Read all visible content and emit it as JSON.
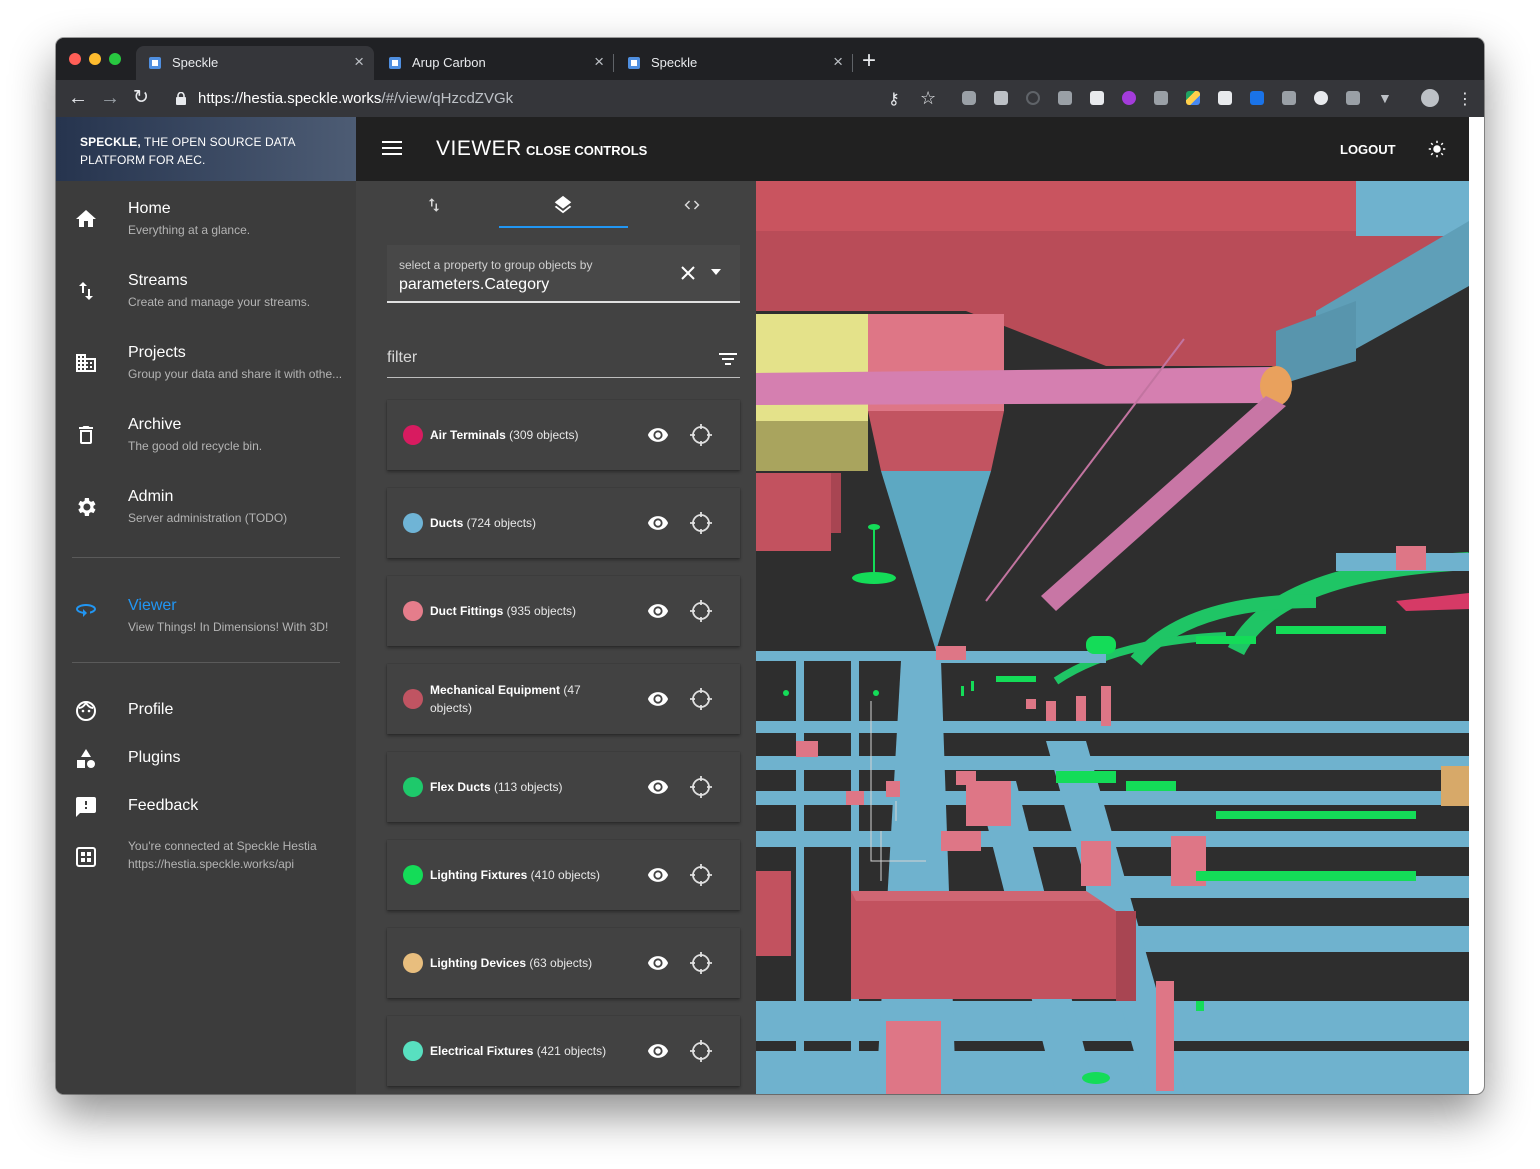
{
  "browser": {
    "tabs": [
      {
        "title": "Speckle",
        "active": true
      },
      {
        "title": "Arup Carbon",
        "active": false
      },
      {
        "title": "Speckle",
        "active": false
      }
    ],
    "url_host": "https://hestia.speckle.works",
    "url_path": "/#/view/qHzcdZVGk"
  },
  "brand": {
    "name": "SPECKLE,",
    "tagline": " THE OPEN SOURCE DATA PLATFORM FOR AEC."
  },
  "sidebar": {
    "items": [
      {
        "title": "Home",
        "subtitle": "Everything at a glance.",
        "icon": "home-icon"
      },
      {
        "title": "Streams",
        "subtitle": "Create and manage your streams.",
        "icon": "swap-vertical-icon"
      },
      {
        "title": "Projects",
        "subtitle": "Group your data and share it with othe...",
        "icon": "building-icon"
      },
      {
        "title": "Archive",
        "subtitle": "The good old recycle bin.",
        "icon": "trash-icon"
      },
      {
        "title": "Admin",
        "subtitle": "Server administration (TODO)",
        "icon": "gear-icon"
      }
    ],
    "viewer": {
      "title": "Viewer",
      "subtitle": "View Things! In Dimensions! With 3D!",
      "icon": "rotate-3d-icon",
      "color": "#2196f3"
    },
    "bottom_items": [
      {
        "title": "Profile",
        "icon": "face-icon"
      },
      {
        "title": "Plugins",
        "icon": "shapes-icon"
      },
      {
        "title": "Feedback",
        "icon": "feedback-icon"
      }
    ],
    "connection_line1": "You're connected at Speckle Hestia",
    "connection_line2": "https://hestia.speckle.works/api"
  },
  "header": {
    "title": "VIEWER",
    "close_controls": "CLOSE CONTROLS",
    "logout": "LOGOUT"
  },
  "controls": {
    "group_label": "select a property to group objects by",
    "group_value": "parameters.Category",
    "filter_placeholder": "filter",
    "layers": [
      {
        "name": "Air Terminals",
        "count": " (309 objects)",
        "color": "#d81b60"
      },
      {
        "name": "Ducts",
        "count": " (724 objects)",
        "color": "#6fb4d6"
      },
      {
        "name": "Duct Fittings",
        "count": " (935 objects)",
        "color": "#e57d8b"
      },
      {
        "name": "Mechanical Equipment",
        "count": " (47 objects)",
        "color": "#c05462"
      },
      {
        "name": "Flex Ducts",
        "count": " (113 objects)",
        "color": "#1ec96b"
      },
      {
        "name": "Lighting Fixtures",
        "count": " (410 objects)",
        "color": "#14dc58"
      },
      {
        "name": "Lighting Devices",
        "count": " (63 objects)",
        "color": "#e8be7e"
      },
      {
        "name": "Electrical Fixtures",
        "count": " (421 objects)",
        "color": "#58e0c0"
      }
    ]
  },
  "colors": {
    "accent": "#2196f3",
    "duct": "#6db4d2",
    "mech": "#c2555f",
    "flex": "#1fc565",
    "yellow": "#e6e38a"
  }
}
